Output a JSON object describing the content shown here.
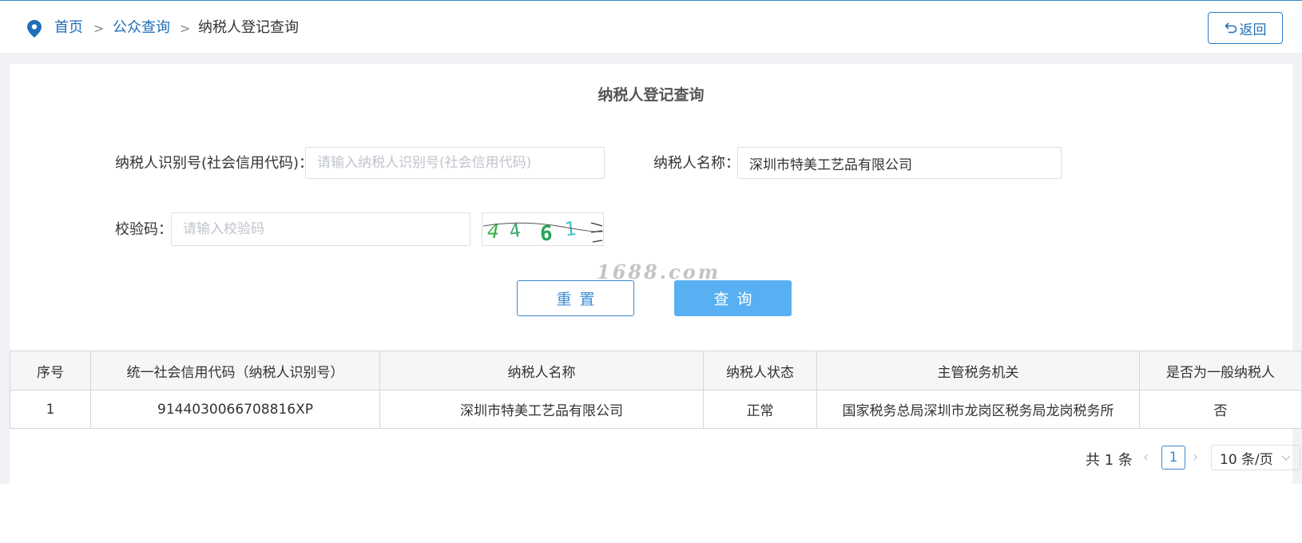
{
  "breadcrumb": {
    "home": "首页",
    "public_query": "公众查询",
    "current": "纳税人登记查询",
    "separator": ">"
  },
  "back_button": "返回",
  "page_title": "纳税人登记查询",
  "form": {
    "taxpayer_id_label": "纳税人识别号(社会信用代码)：",
    "taxpayer_id_value": "",
    "taxpayer_id_placeholder": "请输入纳税人识别号(社会信用代码)",
    "taxpayer_name_label": "纳税人名称：",
    "taxpayer_name_value": "深圳市特美工艺品有限公司",
    "captcha_label": "校验码：",
    "captcha_placeholder": "请输入校验码",
    "captcha_image_text": "4461"
  },
  "watermark": "1688.com",
  "buttons": {
    "reset": "重置",
    "query": "查询"
  },
  "table": {
    "headers": [
      "序号",
      "统一社会信用代码（纳税人识别号）",
      "纳税人名称",
      "纳税人状态",
      "主管税务机关",
      "是否为一般纳税人"
    ],
    "rows": [
      [
        "1",
        "9144030066708816XP",
        "深圳市特美工艺品有限公司",
        "正常",
        "国家税务总局深圳市龙岗区税务局龙岗税务所",
        "否"
      ]
    ]
  },
  "pagination": {
    "total": "共 1 条",
    "current_page": "1",
    "page_size": "10 条/页"
  },
  "colors": {
    "accent": "#1f6fb8",
    "query_button": "#58b0f2",
    "header_bg": "#f5f6f7"
  }
}
